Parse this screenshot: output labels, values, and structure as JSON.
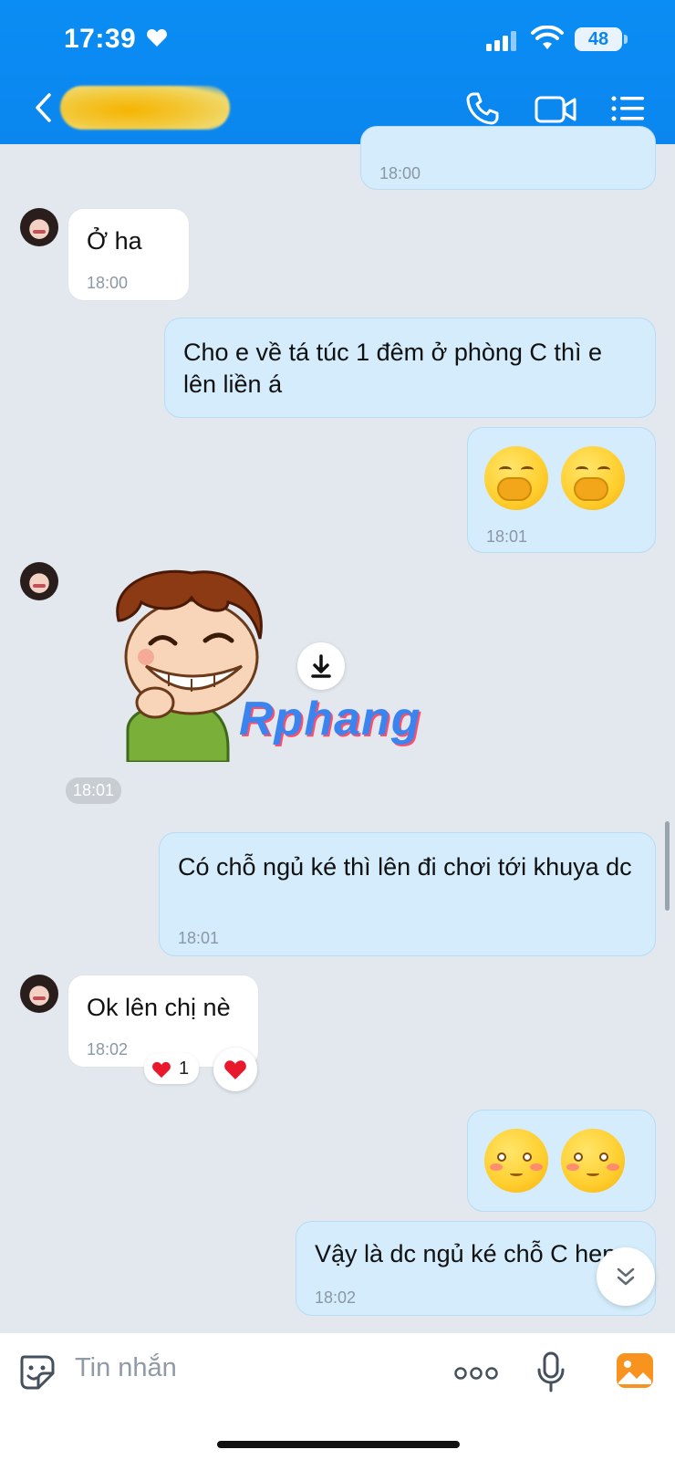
{
  "status_bar": {
    "time": "17:39",
    "battery": "48"
  },
  "header": {
    "contact_name": ""
  },
  "messages": [
    {
      "direction": "out",
      "text": "",
      "time": "18:00"
    },
    {
      "direction": "in",
      "text": "Ở ha",
      "time": "18:00"
    },
    {
      "direction": "out",
      "text": "Cho e về tá túc 1 đêm ở phòng C thì e lên liền á"
    },
    {
      "direction": "out",
      "emoji": [
        "hand-over-mouth-emoji",
        "hand-over-mouth-emoji"
      ],
      "time": "18:01"
    },
    {
      "direction": "in",
      "sticker": "laughing-boy-sticker",
      "time": "18:01"
    },
    {
      "direction": "out",
      "text": "Có chỗ ngủ ké thì lên đi chơi tới khuya dc",
      "time": "18:01"
    },
    {
      "direction": "in",
      "text": "Ok lên chị nè",
      "time": "18:02",
      "reaction_count": "1"
    },
    {
      "direction": "out",
      "emoji": [
        "blushing-emoji",
        "blushing-emoji"
      ]
    },
    {
      "direction": "out",
      "text": "Vậy là dc ngủ ké chỗ C hen",
      "time": "18:02"
    }
  ],
  "watermark": "Rphang",
  "composer": {
    "placeholder": "Tin nhắn"
  },
  "colors": {
    "header": "#0b86ef",
    "outgoing_bubble": "#d4ecfb",
    "incoming_bubble": "#ffffff",
    "background": "#e2e8ee"
  }
}
